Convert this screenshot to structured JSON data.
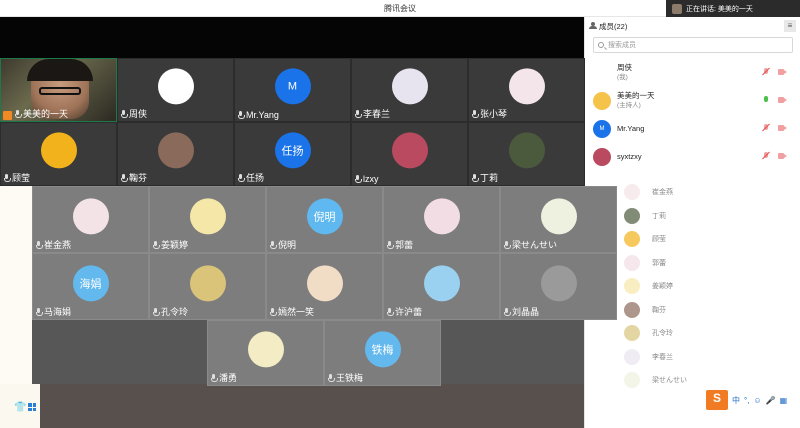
{
  "window": {
    "title": "腾讯会议"
  },
  "speaking": {
    "label": "正在讲话: 美美的一天"
  },
  "upper_tiles": [
    {
      "name": "美美的一天",
      "kind": "video"
    },
    {
      "name": "周侠",
      "color": "#ffffff",
      "icon": "clover-avatar"
    },
    {
      "name": "Mr.Yang",
      "color": "#1a73e8",
      "initial": "M"
    },
    {
      "name": "李春兰",
      "color": "#e8e4ef"
    },
    {
      "name": "张小琴",
      "color": "#f3e5ea"
    },
    {
      "name": "顾莹",
      "color": "#f2b21b"
    },
    {
      "name": "鞠芬",
      "color": "#8a6a5a"
    },
    {
      "name": "任扬",
      "color": "#1a73e8",
      "initial": "任扬"
    },
    {
      "name": "lzxy",
      "color": "#b94a5f"
    },
    {
      "name": "丁莉",
      "color": "#4b5a3c"
    }
  ],
  "lower_tiles": [
    {
      "name": "崔金燕",
      "color": "#f3e3e7"
    },
    {
      "name": "姜颖婷",
      "color": "#f5e7a8"
    },
    {
      "name": "倪明",
      "color": "#5fb8ef",
      "initial": "倪明"
    },
    {
      "name": "郭蕾",
      "color": "#f2dde4"
    },
    {
      "name": "梁せんせい",
      "color": "#eef1e0"
    },
    {
      "name": "马海娟",
      "color": "#63b9ee",
      "initial": "海娟"
    },
    {
      "name": "孔令玲",
      "color": "#d9c47a"
    },
    {
      "name": "嫣然一笑",
      "color": "#f1dcc5"
    },
    {
      "name": "许沪蕾",
      "color": "#9ad0f0"
    },
    {
      "name": "刘晶晶",
      "color": "#9a9a9a"
    },
    {
      "name": "潘勇",
      "color": "#f3ecc4"
    },
    {
      "name": "王铁梅",
      "color": "#63b9ee",
      "initial": "铁梅"
    }
  ],
  "sidebar": {
    "header": "成员(22)",
    "menu": "≡",
    "search_placeholder": "搜索成员",
    "members": [
      {
        "name": "周侠",
        "sub": "(我)",
        "color": "#ffffff"
      },
      {
        "name": "美美的一天",
        "sub": "(主持人)",
        "color": "#f5c34a",
        "mic_on": true
      },
      {
        "name": "Mr.Yang",
        "sub": "",
        "color": "#1a73e8",
        "initial": "M"
      },
      {
        "name": "syxtzxy",
        "sub": "",
        "color": "#b94a5f"
      }
    ],
    "ghost_members": [
      {
        "name": "崔金燕",
        "color": "#f3e3e7"
      },
      {
        "name": "丁莉",
        "color": "#4b5a3c"
      },
      {
        "name": "顾莹",
        "color": "#f2b21b"
      },
      {
        "name": "郭蕾",
        "color": "#f2dde4"
      },
      {
        "name": "姜颖婷",
        "color": "#f5e7a8"
      },
      {
        "name": "鞠芬",
        "color": "#8a6a5a"
      },
      {
        "name": "孔令玲",
        "color": "#d9c47a"
      },
      {
        "name": "李春兰",
        "color": "#e8e4ef"
      },
      {
        "name": "梁せんせい",
        "color": "#eef1e0"
      }
    ]
  },
  "ime": {
    "logo": "S",
    "items": [
      "中",
      "°,",
      "☺",
      "🎤",
      "▦"
    ]
  }
}
